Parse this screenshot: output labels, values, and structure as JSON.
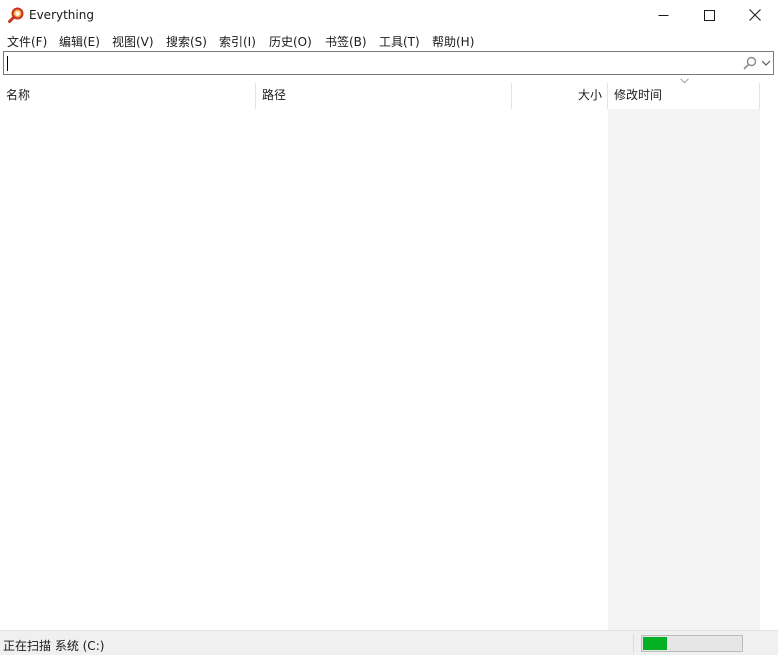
{
  "window": {
    "title": "Everything",
    "icons": {
      "app": "magnifier-logo-icon",
      "minimize": "minimize-icon",
      "maximize": "maximize-icon",
      "close": "close-icon"
    }
  },
  "menu": {
    "items": [
      "文件(F)",
      "编辑(E)",
      "视图(V)",
      "搜索(S)",
      "索引(I)",
      "历史(O)",
      "书签(B)",
      "工具(T)",
      "帮助(H)"
    ]
  },
  "search": {
    "value": "",
    "placeholder": "",
    "icons": {
      "search": "search-icon",
      "dropdown": "chevron-down-icon"
    }
  },
  "columns": {
    "name": "名称",
    "path": "路径",
    "size": "大小",
    "modified": "修改时间",
    "sorted_by": "modified",
    "sort_direction": "descending"
  },
  "results": [],
  "status": {
    "text": "正在扫描 系统 (C:)",
    "progress_fraction": 0.24,
    "progress_color": "#06b025"
  },
  "colors": {
    "sorted_column_bg": "#f4f4f4",
    "status_bar_bg": "#f0f0f0",
    "accent_green": "#06b025"
  }
}
